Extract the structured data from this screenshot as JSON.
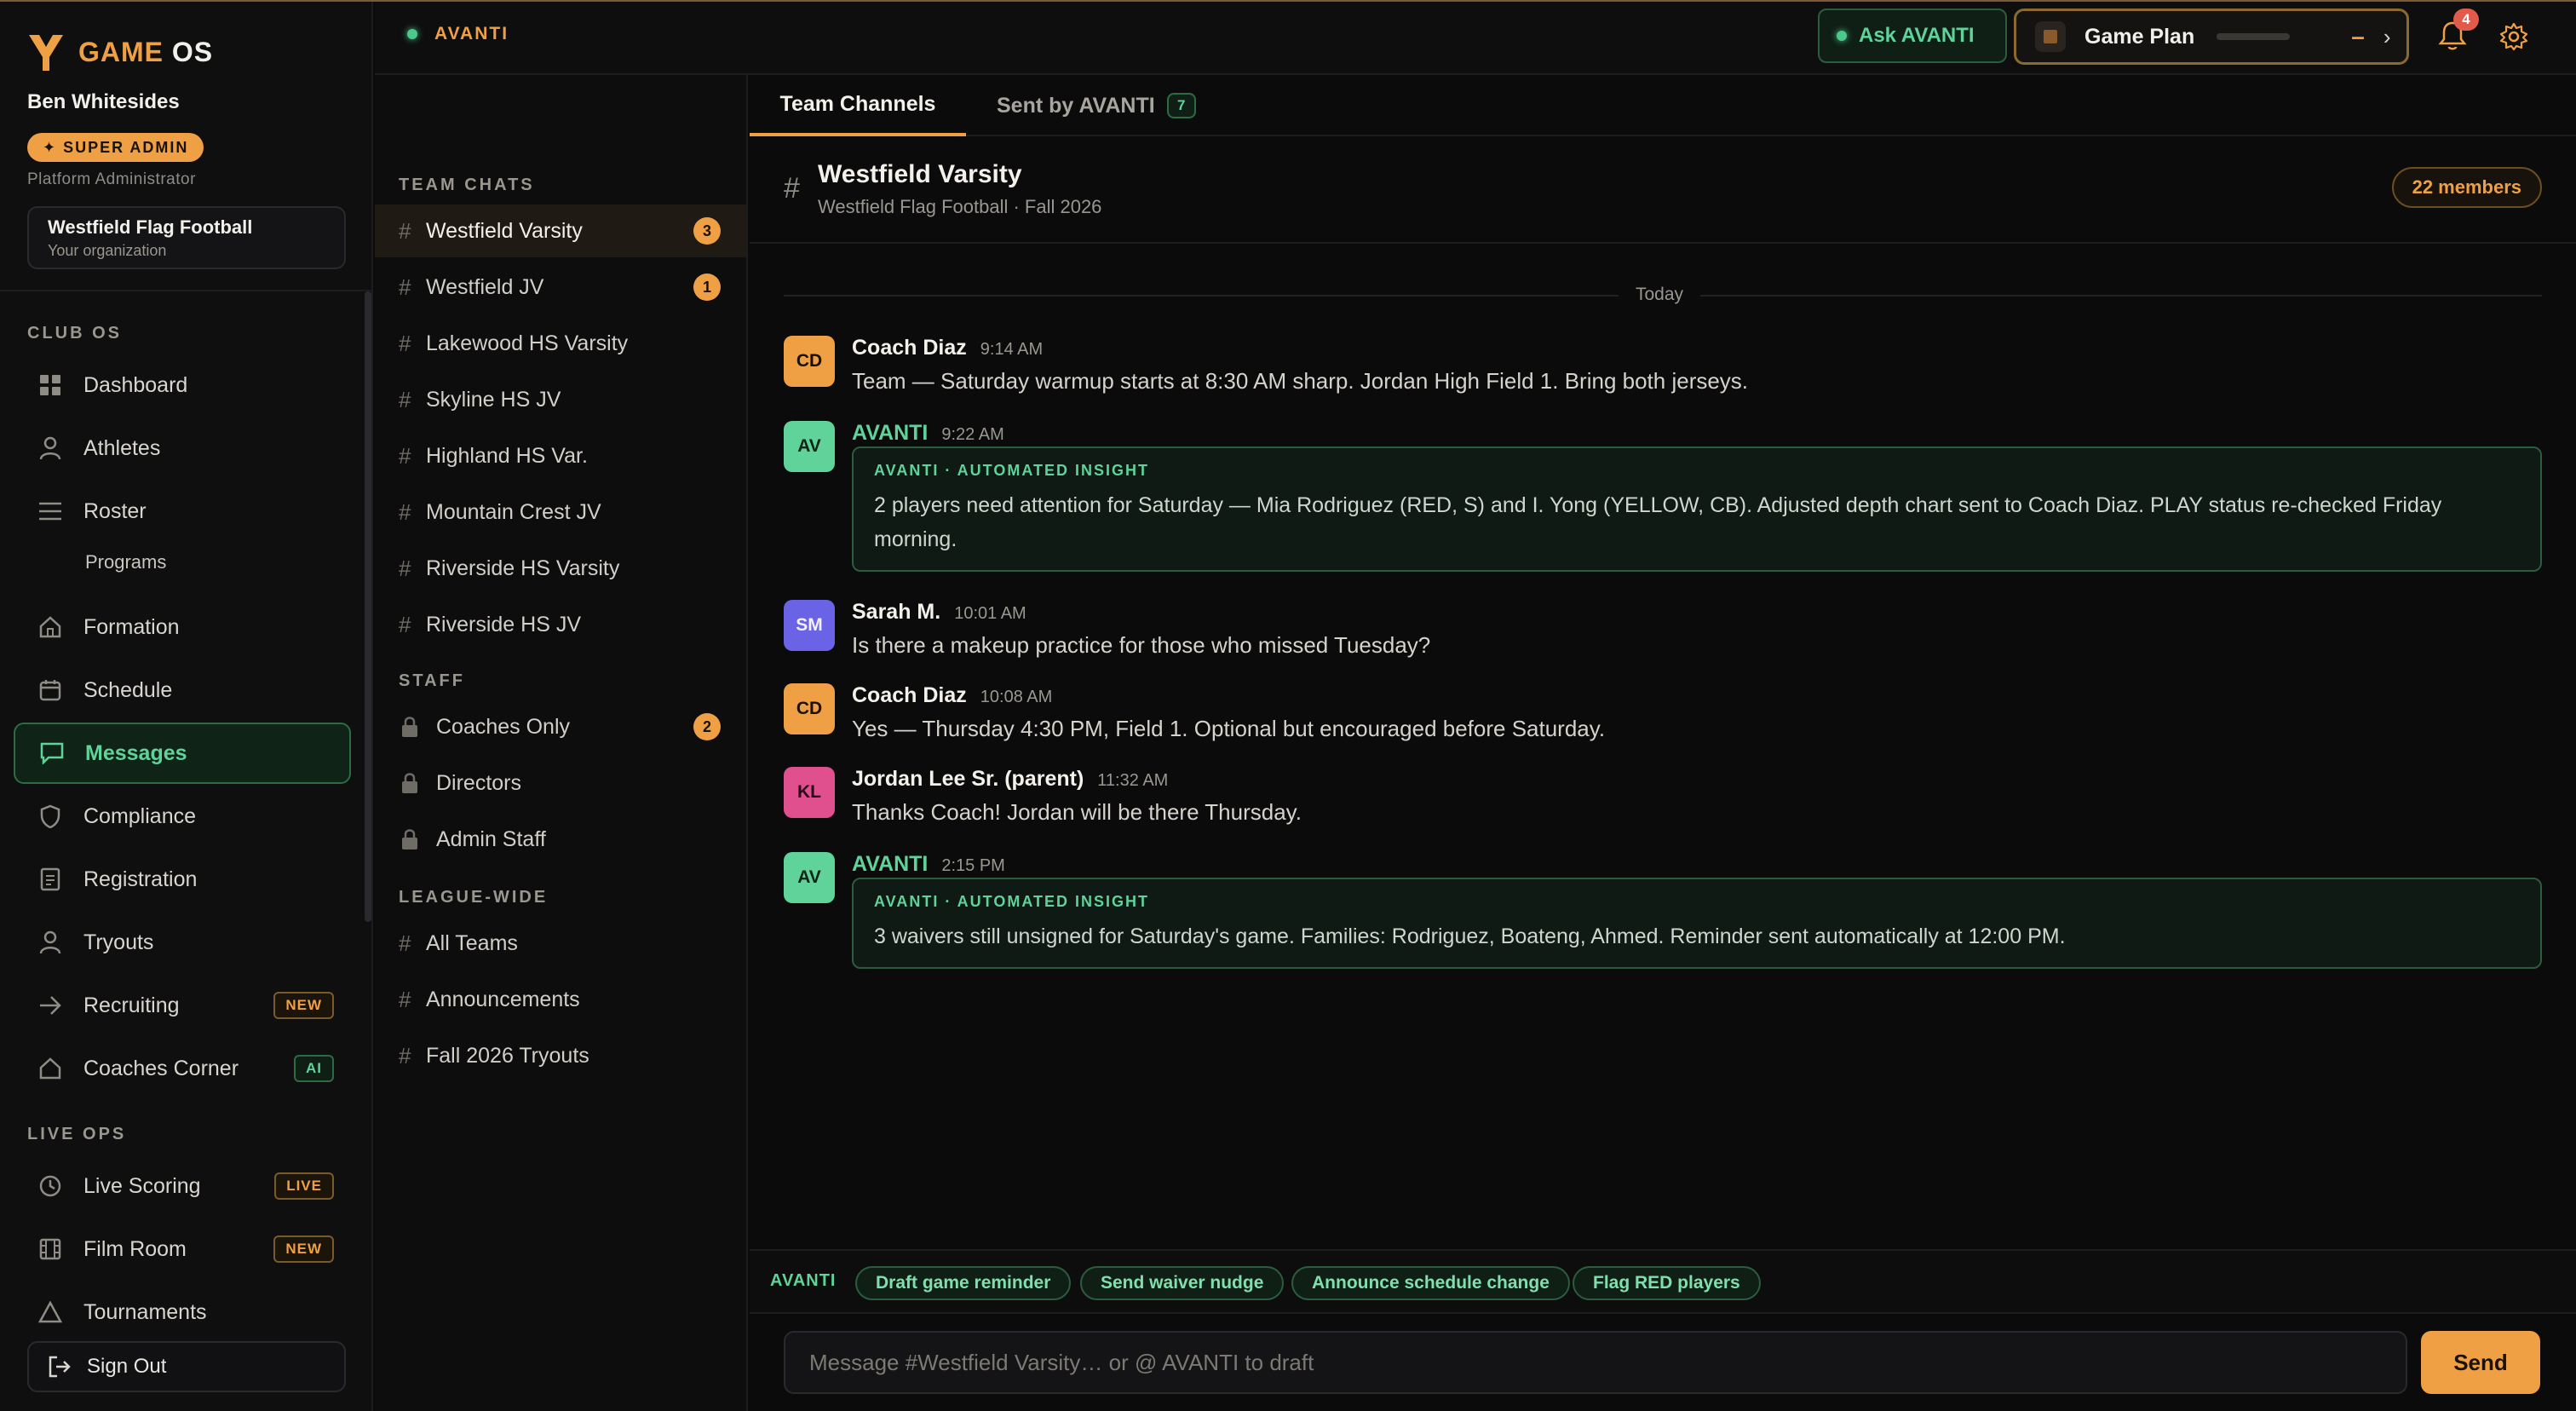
{
  "brand": {
    "word1": "GAME",
    "word2": "OS",
    "color": "#f0a044"
  },
  "user": {
    "name": "Ben Whitesides",
    "role_badge": "✦ SUPER ADMIN",
    "role_sub": "Platform Administrator"
  },
  "org": {
    "name": "Westfield Flag Football",
    "sub": "Your organization"
  },
  "nav": {
    "section_club": "CLUB OS",
    "section_live": "LIVE OPS",
    "items": [
      {
        "label": "Dashboard",
        "icon": "grid-icon"
      },
      {
        "label": "Athletes",
        "icon": "person-icon"
      },
      {
        "label": "Roster",
        "icon": "list-icon"
      },
      {
        "label": "Programs",
        "icon": ""
      },
      {
        "label": "Formation",
        "icon": "home-icon"
      },
      {
        "label": "Schedule",
        "icon": "calendar-icon"
      },
      {
        "label": "Messages",
        "icon": "chat-icon",
        "active": true
      },
      {
        "label": "Compliance",
        "icon": "shield-icon"
      },
      {
        "label": "Registration",
        "icon": "document-icon"
      },
      {
        "label": "Tryouts",
        "icon": "person-icon"
      },
      {
        "label": "Recruiting",
        "icon": "arrow-right-icon",
        "tag": "NEW"
      },
      {
        "label": "Coaches Corner",
        "icon": "home-icon",
        "tag": "AI"
      }
    ],
    "live_items": [
      {
        "label": "Live Scoring",
        "icon": "clock-icon",
        "tag": "LIVE"
      },
      {
        "label": "Film Room",
        "icon": "film-icon",
        "tag": "NEW"
      },
      {
        "label": "Tournaments",
        "icon": "triangle-icon"
      }
    ],
    "signout": "Sign Out"
  },
  "topbar": {
    "status_label": "AVANTI",
    "ask_label": "Ask AVANTI",
    "game_plan_label": "Game Plan",
    "game_plan_minus": "–",
    "game_plan_arrow": "›",
    "notifications_count": "4"
  },
  "channels": {
    "team_section": "TEAM CHATS",
    "staff_section": "STAFF",
    "league_section": "LEAGUE-WIDE",
    "team": [
      {
        "name": "Westfield Varsity",
        "count": "3",
        "active": true
      },
      {
        "name": "Westfield JV",
        "count": "1"
      },
      {
        "name": "Lakewood HS Varsity"
      },
      {
        "name": "Skyline HS JV"
      },
      {
        "name": "Highland HS Var."
      },
      {
        "name": "Mountain Crest JV"
      },
      {
        "name": "Riverside HS Varsity"
      },
      {
        "name": "Riverside HS JV"
      }
    ],
    "staff": [
      {
        "name": "Coaches Only",
        "count": "2"
      },
      {
        "name": "Directors"
      },
      {
        "name": "Admin Staff"
      }
    ],
    "league": [
      {
        "name": "All Teams"
      },
      {
        "name": "Announcements"
      },
      {
        "name": "Fall 2026 Tryouts"
      }
    ]
  },
  "tabs": {
    "team": "Team Channels",
    "sent": "Sent by AVANTI",
    "sent_count": "7"
  },
  "channel_header": {
    "hash": "#",
    "title": "Westfield Varsity",
    "sub": "Westfield Flag Football · Fall 2026",
    "members": "22 members"
  },
  "day_label": "Today",
  "messages": [
    {
      "initials": "CD",
      "author": "Coach Diaz",
      "time": "9:14 AM",
      "body": "Team — Saturday warmup starts at 8:30 AM sharp. Jordan High Field 1. Bring both jerseys."
    },
    {
      "initials": "AV",
      "author": "AVANTI",
      "time": "9:22 AM",
      "insight_tag": "AVANTI · AUTOMATED INSIGHT",
      "body": "2 players need attention for Saturday — Mia Rodriguez (RED, S) and I. Yong (YELLOW, CB). Adjusted depth chart sent to Coach Diaz. PLAY status re-checked Friday morning."
    },
    {
      "initials": "SM",
      "author": "Sarah M.",
      "time": "10:01 AM",
      "body": "Is there a makeup practice for those who missed Tuesday?"
    },
    {
      "initials": "CD",
      "author": "Coach Diaz",
      "time": "10:08 AM",
      "body": "Yes — Thursday 4:30 PM, Field 1. Optional but encouraged before Saturday."
    },
    {
      "initials": "KL",
      "author": "Jordan Lee Sr. (parent)",
      "time": "11:32 AM",
      "body": "Thanks Coach! Jordan will be there Thursday."
    },
    {
      "initials": "AV",
      "author": "AVANTI",
      "time": "2:15 PM",
      "insight_tag": "AVANTI · AUTOMATED INSIGHT",
      "body": "3 waivers still unsigned for Saturday's game. Families: Rodriguez, Boateng, Ahmed. Reminder sent automatically at 12:00 PM."
    }
  ],
  "suggestions": {
    "label": "AVANTI",
    "chips": [
      "Draft game reminder",
      "Send waiver nudge",
      "Announce schedule change",
      "Flag RED players"
    ]
  },
  "composer": {
    "placeholder": "Message #Westfield Varsity… or @ AVANTI to draft",
    "send": "Send"
  },
  "colors": {
    "accent": "#f0a044",
    "ai_green": "#5fd39a",
    "background": "#0b0b0c"
  }
}
